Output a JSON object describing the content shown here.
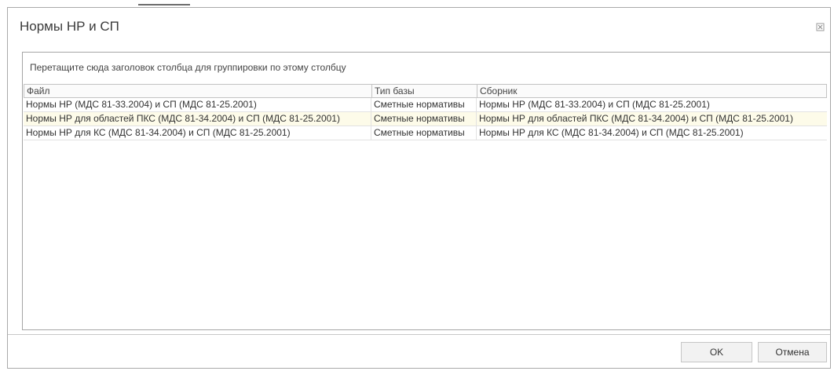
{
  "dialog": {
    "title": "Нормы НР и СП"
  },
  "grid": {
    "group_panel_text": "Перетащите сюда заголовок столбца для группировки по этому столбцу",
    "columns": [
      "Файл",
      "Тип базы",
      "Сборник"
    ],
    "rows": [
      [
        "Нормы НР (МДС 81-33.2004) и СП (МДС 81-25.2001)",
        "Сметные нормативы",
        "Нормы НР (МДС 81-33.2004) и СП (МДС 81-25.2001)"
      ],
      [
        "Нормы НР для областей ПКС (МДС 81-34.2004) и СП (МДС 81-25.2001)",
        "Сметные нормативы",
        "Нормы НР для областей ПКС (МДС 81-34.2004) и СП (МДС 81-25.2001)"
      ],
      [
        "Нормы НР для КС (МДС 81-34.2004) и СП (МДС 81-25.2001)",
        "Сметные нормативы",
        "Нормы НР для КС (МДС 81-34.2004) и СП (МДС 81-25.2001)"
      ]
    ],
    "selected_row": 1
  },
  "buttons": {
    "ok_label": "OK",
    "cancel_label": "Отмена"
  },
  "colors": {
    "selected_row_bg": "#fdfbe9",
    "border": "#a5a5a5"
  },
  "icons": {
    "close": "close-icon"
  }
}
